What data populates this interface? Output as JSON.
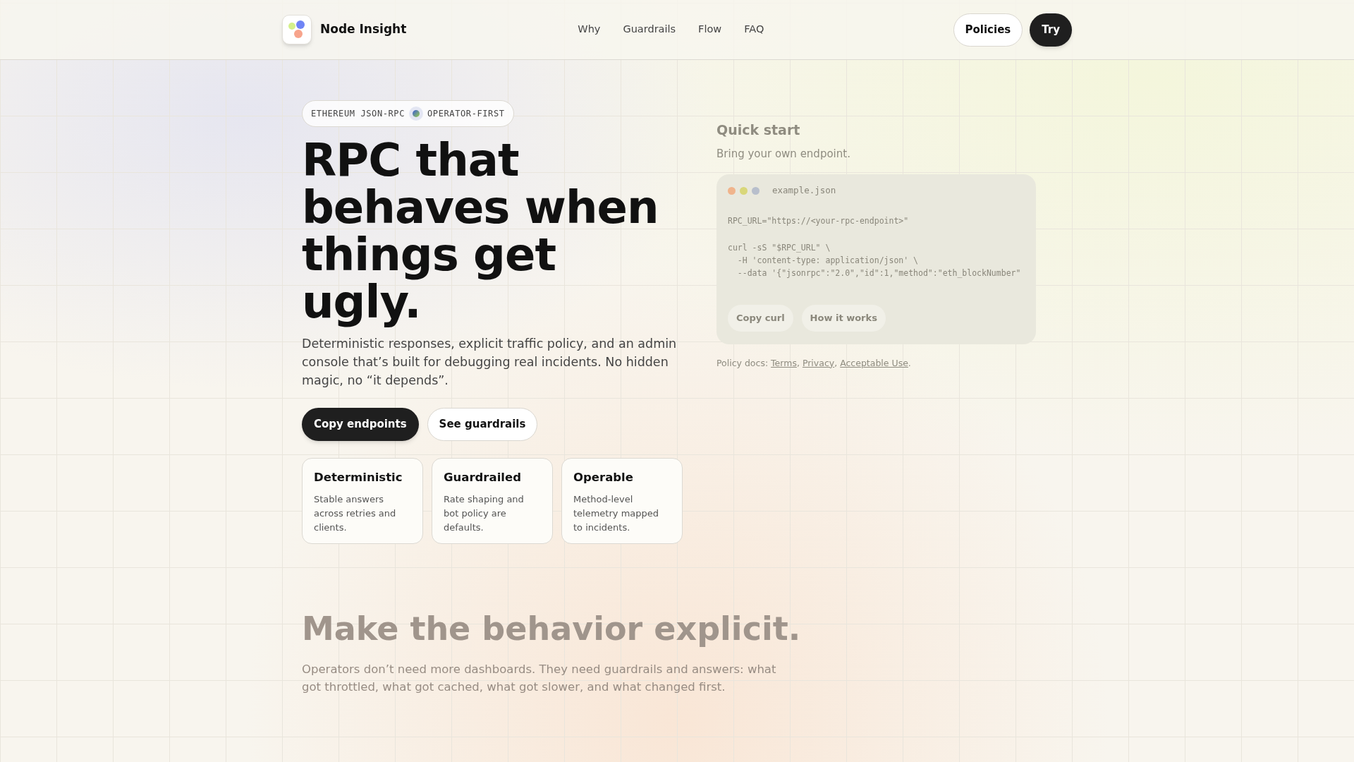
{
  "brand": {
    "name": "Node Insight"
  },
  "nav": [
    {
      "label": "Why"
    },
    {
      "label": "Guardrails"
    },
    {
      "label": "Flow"
    },
    {
      "label": "FAQ"
    }
  ],
  "header_actions": [
    {
      "label": "Policies",
      "kind": "secondary"
    },
    {
      "label": "Try",
      "kind": "primary"
    }
  ],
  "hero": {
    "badge": [
      "ETHEREUM JSON-RPC",
      "OPERATOR-FIRST"
    ],
    "title": "RPC that behaves when things get ugly.",
    "lead": "Deterministic responses, explicit traffic policy, and an admin console that’s built for debugging real incidents. No hidden magic, no “it depends”.",
    "actions": [
      {
        "label": "Copy endpoints",
        "kind": "primary"
      },
      {
        "label": "See guardrails",
        "kind": "secondary"
      }
    ],
    "features": [
      {
        "title": "Deterministic",
        "text": "Stable answers across retries and clients."
      },
      {
        "title": "Guardrailed",
        "text": "Rate shaping and bot policy are defaults."
      },
      {
        "title": "Operable",
        "text": "Method-level telemetry mapped to incidents."
      }
    ]
  },
  "quick_start": {
    "title": "Quick start",
    "subtitle": "Bring your own endpoint.",
    "code": {
      "filename": "example.json",
      "blocks": [
        [
          "RPC_URL=\"https://<your-rpc-endpoint>\""
        ],
        [
          "curl -sS \"$RPC_URL\" \\",
          "  -H 'content-type: application/json' \\",
          "  --data '{\"jsonrpc\":\"2.0\",\"id\":1,\"method\":\"eth_blockNumber\""
        ]
      ]
    },
    "actions": [
      {
        "label": "Copy curl"
      },
      {
        "label": "How it works"
      }
    ],
    "policy": {
      "label": "Policy docs:",
      "links": [
        {
          "label": "Terms",
          "after": ","
        },
        {
          "label": "Privacy",
          "after": ","
        },
        {
          "label": "Acceptable Use",
          "after": "."
        }
      ]
    }
  },
  "section": {
    "title": "Make the behavior explicit.",
    "text": "Operators don’t need more dashboards. They need guardrails and answers: what got throttled, what got cached, what got slower, and what changed first."
  }
}
